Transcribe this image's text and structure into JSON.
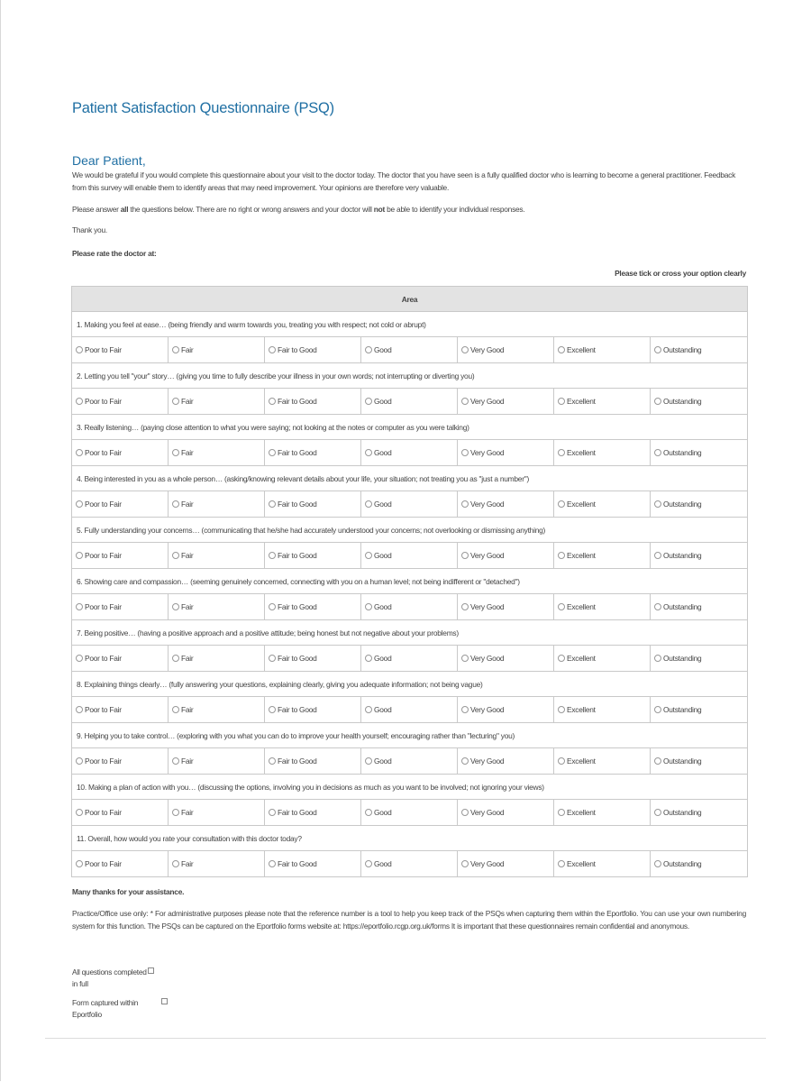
{
  "document": {
    "title": "Patient Satisfaction Questionnaire (PSQ)",
    "greeting": "Dear Patient,",
    "intro_paragraph": "We would be grateful if you would complete this questionnaire about your visit to the doctor today. The doctor that you have seen is a fully qualified doctor who is learning to become a general practitioner. Feedback from this survey will enable them to identify areas that may need improvement. Your opinions are therefore very valuable.",
    "instructions_parts": [
      "Please answer ",
      "all",
      " the questions below. There are no right or wrong answers and your doctor will ",
      "not",
      " be able to identify your individual responses."
    ],
    "thank_you": "Thank you.",
    "rate_prompt": "Please rate the doctor at:",
    "tick_instruction": "Please tick or cross your option clearly",
    "table_header": "Area",
    "rating_options": [
      "Poor to Fair",
      "Fair",
      "Fair to Good",
      "Good",
      "Very Good",
      "Excellent",
      "Outstanding"
    ],
    "questions": [
      "1. Making you feel at ease… (being friendly and warm towards you, treating you with respect; not cold or abrupt)",
      "2. Letting you tell \"your\" story… (giving you time to fully describe your illness in your own words; not interrupting or diverting you)",
      "3. Really listening… (paying close attention to what you were saying; not looking at the notes or computer as you were talking)",
      "4. Being interested in you as a whole person… (asking/knowing relevant details about your life, your situation; not treating you as \"just a number\")",
      "5. Fully understanding your concerns… (communicating that he/she had accurately understood your concerns; not overlooking or dismissing anything)",
      "6. Showing care and compassion… (seeming genuinely concerned, connecting with you on a human level; not being indifferent or \"detached\")",
      "7. Being positive… (having a positive approach and a positive attitude; being honest but not negative about your problems)",
      "8. Explaining things clearly… (fully answering your questions, explaining clearly, giving you adequate information; not being vague)",
      "9. Helping you to take control… (exploring with you what you can do to improve your health yourself; encouraging rather than \"lecturing\" you)",
      "10. Making a plan of action with you… (discussing the options, involving you in decisions as much as you want to be involved; not ignoring your views)",
      "11. Overall, how would you rate your consultation with this doctor today?"
    ],
    "closing_thanks": "Many thanks for your assistance.",
    "admin_note": "Practice/Office use only: * For administrative purposes please note that the reference number is a tool to help you keep track of the PSQs when capturing them within the Eportfolio. You can use your own numbering system for this function. The PSQs can be captured on the Eportfolio forms website at: https://eportfolio.rcgp.org.uk/forms It is important that these questionnaires remain confidential and anonymous.",
    "checkboxes": [
      {
        "label_line1": "All questions completed",
        "label_line2": "in full"
      },
      {
        "label_line1": "Form captured within",
        "label_line2": "Eportfolio"
      }
    ]
  }
}
